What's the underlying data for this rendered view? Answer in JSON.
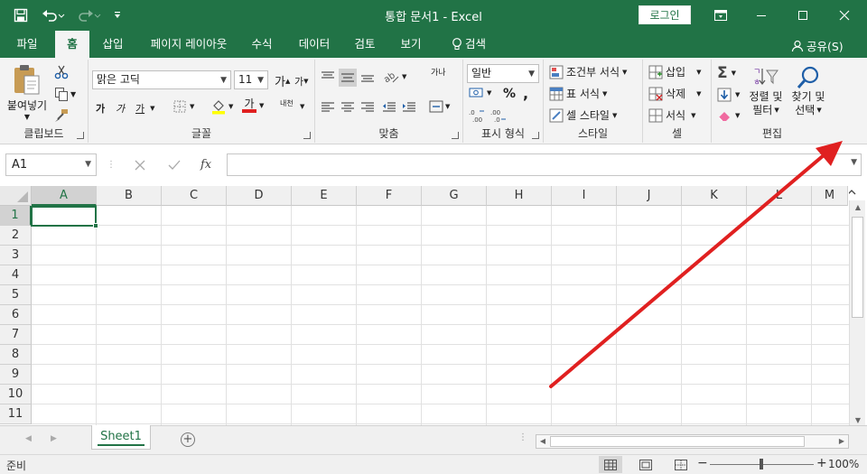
{
  "titlebar": {
    "title": "통합 문서1  -  Excel",
    "login_label": "로그인",
    "bg_color": "#217346"
  },
  "tabs": [
    {
      "label": "파일"
    },
    {
      "label": "홈",
      "active": true
    },
    {
      "label": "삽입"
    },
    {
      "label": "페이지 레이아웃"
    },
    {
      "label": "수식"
    },
    {
      "label": "데이터"
    },
    {
      "label": "검토"
    },
    {
      "label": "보기"
    },
    {
      "label": "검색"
    }
  ],
  "share_label": "공유(S)",
  "ribbon": {
    "clipboard": {
      "paste_label": "붙여넣기",
      "group_label": "클립보드"
    },
    "font": {
      "font_name": "맑은 고딕",
      "font_size": "11",
      "bold": "가",
      "italic": "가",
      "underline": "가",
      "font_color_glyph": "가",
      "phonetic": "내천",
      "group_label": "글꼴"
    },
    "alignment": {
      "wrap_glyph": "가나",
      "group_label": "맞춤"
    },
    "number": {
      "format": "일반",
      "percent": "%",
      "comma": ",",
      "group_label": "표시 형식"
    },
    "styles": {
      "conditional": "조건부 서식",
      "table": "표 서식",
      "cell_style": "셀 스타일",
      "group_label": "스타일"
    },
    "cells": {
      "insert": "삽입",
      "delete": "삭제",
      "format": "서식",
      "group_label": "셀"
    },
    "editing": {
      "sort_line1": "정렬 및",
      "sort_line2": "필터",
      "find_line1": "찾기 및",
      "find_line2": "선택",
      "group_label": "편집"
    }
  },
  "formula_bar": {
    "name_box": "A1",
    "fx_label": "fx",
    "formula": ""
  },
  "grid": {
    "columns": [
      "A",
      "B",
      "C",
      "D",
      "E",
      "F",
      "G",
      "H",
      "I",
      "J",
      "K",
      "L",
      "M"
    ],
    "rows": [
      "1",
      "2",
      "3",
      "4",
      "5",
      "6",
      "7",
      "8",
      "9",
      "10",
      "11"
    ],
    "selected_cell": "A1"
  },
  "sheets": [
    {
      "name": "Sheet1",
      "active": true
    }
  ],
  "statusbar": {
    "status": "준비",
    "zoom": "100%",
    "zoom_minus": "−",
    "zoom_plus": "+"
  },
  "annotation": {
    "color": "#e02020"
  }
}
